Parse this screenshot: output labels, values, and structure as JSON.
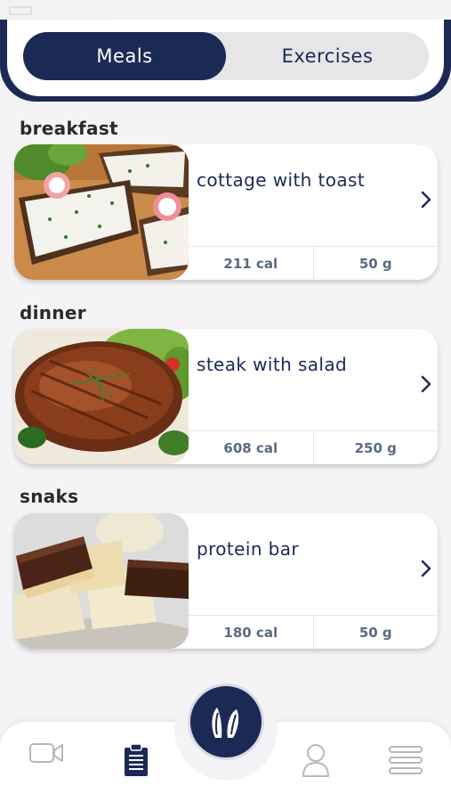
{
  "tabs": {
    "meals": "Meals",
    "exercises": "Exercises"
  },
  "sections": [
    {
      "title": "breakfast",
      "meal": {
        "name": "cottage with toast",
        "calories": "211 cal",
        "weight": "50 g"
      }
    },
    {
      "title": "dinner",
      "meal": {
        "name": "steak with salad",
        "calories": "608 cal",
        "weight": "250 g"
      }
    },
    {
      "title": "snaks",
      "meal": {
        "name": "protein bar",
        "calories": "180 cal",
        "weight": "50 g"
      }
    }
  ],
  "nav": {
    "icons": [
      "video-icon",
      "clipboard-icon",
      "bunny-logo-icon",
      "profile-icon",
      "menu-icon"
    ],
    "active": "clipboard-icon"
  },
  "colors": {
    "primary": "#1b2a55",
    "background": "#f4f4f6",
    "segment_bg": "#e6e6e8",
    "stat_text": "#5a6a80"
  }
}
